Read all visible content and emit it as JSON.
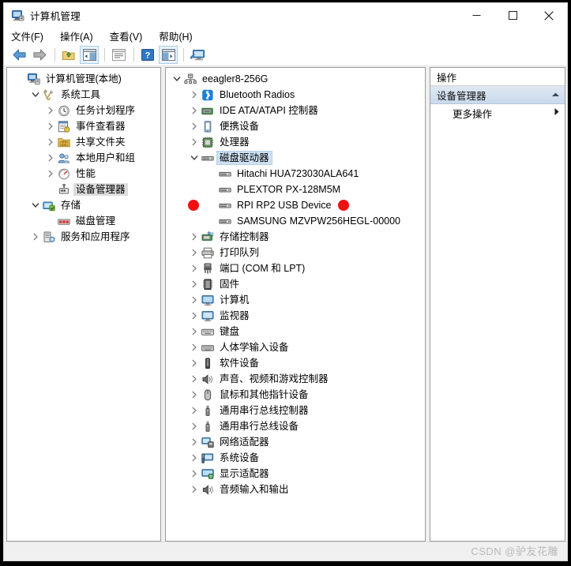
{
  "window": {
    "title": "计算机管理",
    "title_icon": "computer-management-icon",
    "minimize_label": "最小化",
    "maximize_label": "最大化",
    "close_label": "关闭"
  },
  "menubar": {
    "items": [
      {
        "label": "文件(F)",
        "name": "menu-file"
      },
      {
        "label": "操作(A)",
        "name": "menu-action"
      },
      {
        "label": "查看(V)",
        "name": "menu-view"
      },
      {
        "label": "帮助(H)",
        "name": "menu-help"
      }
    ]
  },
  "toolbar": {
    "buttons": [
      {
        "name": "back-button",
        "icon": "back-arrow-icon",
        "tooltip": "后退"
      },
      {
        "name": "forward-button",
        "icon": "forward-arrow-icon",
        "tooltip": "前进"
      },
      {
        "name": "up-folder-button",
        "icon": "folder-up-icon",
        "tooltip": "向上"
      },
      {
        "name": "show-console-tree-button",
        "icon": "console-tree-icon",
        "tooltip": "显示/隐藏控制台树"
      },
      {
        "name": "properties-button",
        "icon": "properties-icon",
        "tooltip": "属性"
      },
      {
        "name": "help-button",
        "icon": "help-question-icon",
        "tooltip": "帮助"
      },
      {
        "name": "show-action-pane-button",
        "icon": "action-pane-icon",
        "tooltip": "显示/隐藏操作窗格"
      },
      {
        "name": "scan-hardware-button",
        "icon": "monitor-scan-icon",
        "tooltip": "扫描检测硬件改动"
      }
    ]
  },
  "left_tree": {
    "root": {
      "label": "计算机管理(本地)",
      "icon": "computer-management-icon",
      "indent": 0,
      "twisty": "none"
    },
    "nodes": [
      {
        "label": "系统工具",
        "icon": "system-tools-icon",
        "indent": 1,
        "twisty": "expanded"
      },
      {
        "label": "任务计划程序",
        "icon": "task-scheduler-icon",
        "indent": 2,
        "twisty": "collapsed"
      },
      {
        "label": "事件查看器",
        "icon": "event-viewer-icon",
        "indent": 2,
        "twisty": "collapsed"
      },
      {
        "label": "共享文件夹",
        "icon": "shared-folders-icon",
        "indent": 2,
        "twisty": "collapsed"
      },
      {
        "label": "本地用户和组",
        "icon": "local-users-icon",
        "indent": 2,
        "twisty": "collapsed"
      },
      {
        "label": "性能",
        "icon": "performance-icon",
        "indent": 2,
        "twisty": "collapsed"
      },
      {
        "label": "设备管理器",
        "icon": "device-manager-icon",
        "indent": 2,
        "twisty": "none",
        "selected": true
      },
      {
        "label": "存储",
        "icon": "storage-icon",
        "indent": 1,
        "twisty": "expanded"
      },
      {
        "label": "磁盘管理",
        "icon": "disk-management-icon",
        "indent": 2,
        "twisty": "none"
      },
      {
        "label": "服务和应用程序",
        "icon": "services-apps-icon",
        "indent": 1,
        "twisty": "collapsed"
      }
    ]
  },
  "device_tree": {
    "root": {
      "label": "eeagler8-256G",
      "icon": "computer-node-icon",
      "indent": 0,
      "twisty": "expanded"
    },
    "nodes": [
      {
        "label": "Bluetooth Radios",
        "icon": "bluetooth-icon",
        "indent": 1,
        "twisty": "collapsed"
      },
      {
        "label": "IDE ATA/ATAPI 控制器",
        "icon": "ide-controller-icon",
        "indent": 1,
        "twisty": "collapsed"
      },
      {
        "label": "便携设备",
        "icon": "portable-device-icon",
        "indent": 1,
        "twisty": "collapsed"
      },
      {
        "label": "处理器",
        "icon": "processor-icon",
        "indent": 1,
        "twisty": "collapsed"
      },
      {
        "label": "磁盘驱动器",
        "icon": "disk-drive-icon",
        "indent": 1,
        "twisty": "expanded",
        "selected": true
      },
      {
        "label": "Hitachi HUA723030ALA641",
        "icon": "disk-drive-icon",
        "indent": 2,
        "twisty": "none"
      },
      {
        "label": "PLEXTOR PX-128M5M",
        "icon": "disk-drive-icon",
        "indent": 2,
        "twisty": "none"
      },
      {
        "label": "RPI RP2 USB Device",
        "icon": "disk-drive-icon",
        "indent": 2,
        "twisty": "none",
        "highlight_circles": true
      },
      {
        "label": "SAMSUNG MZVPW256HEGL-00000",
        "icon": "disk-drive-icon",
        "indent": 2,
        "twisty": "none"
      },
      {
        "label": "存储控制器",
        "icon": "storage-controller-icon",
        "indent": 1,
        "twisty": "collapsed"
      },
      {
        "label": "打印队列",
        "icon": "print-queue-icon",
        "indent": 1,
        "twisty": "collapsed"
      },
      {
        "label": "端口 (COM 和 LPT)",
        "icon": "ports-icon",
        "indent": 1,
        "twisty": "collapsed"
      },
      {
        "label": "固件",
        "icon": "firmware-icon",
        "indent": 1,
        "twisty": "collapsed"
      },
      {
        "label": "计算机",
        "icon": "computer-icon",
        "indent": 1,
        "twisty": "collapsed"
      },
      {
        "label": "监视器",
        "icon": "monitor-icon",
        "indent": 1,
        "twisty": "collapsed"
      },
      {
        "label": "键盘",
        "icon": "keyboard-icon",
        "indent": 1,
        "twisty": "collapsed"
      },
      {
        "label": "人体学输入设备",
        "icon": "hid-icon",
        "indent": 1,
        "twisty": "collapsed"
      },
      {
        "label": "软件设备",
        "icon": "software-device-icon",
        "indent": 1,
        "twisty": "collapsed"
      },
      {
        "label": "声音、视频和游戏控制器",
        "icon": "sound-icon",
        "indent": 1,
        "twisty": "collapsed"
      },
      {
        "label": "鼠标和其他指针设备",
        "icon": "mouse-icon",
        "indent": 1,
        "twisty": "collapsed"
      },
      {
        "label": "通用串行总线控制器",
        "icon": "usb-icon",
        "indent": 1,
        "twisty": "collapsed"
      },
      {
        "label": "通用串行总线设备",
        "icon": "usb-icon",
        "indent": 1,
        "twisty": "collapsed"
      },
      {
        "label": "网络适配器",
        "icon": "network-adapter-icon",
        "indent": 1,
        "twisty": "collapsed"
      },
      {
        "label": "系统设备",
        "icon": "system-device-icon",
        "indent": 1,
        "twisty": "collapsed"
      },
      {
        "label": "显示适配器",
        "icon": "display-adapter-icon",
        "indent": 1,
        "twisty": "collapsed"
      },
      {
        "label": "音频输入和输出",
        "icon": "audio-io-icon",
        "indent": 1,
        "twisty": "collapsed"
      }
    ]
  },
  "actions_pane": {
    "header": "操作",
    "group_title": "设备管理器",
    "group_collapse_icon": "chevron-up-icon",
    "rows": [
      {
        "label": "更多操作",
        "name": "action-more-actions",
        "icon": "chevron-right-icon"
      }
    ]
  },
  "statusbar": {
    "watermark": "CSDN @驴友花雕"
  },
  "colors": {
    "accent_selection": "#cde0f2",
    "annotation_red": "#ee1111",
    "window_bg": "#f0f0f0",
    "pane_bg": "#ffffff"
  }
}
